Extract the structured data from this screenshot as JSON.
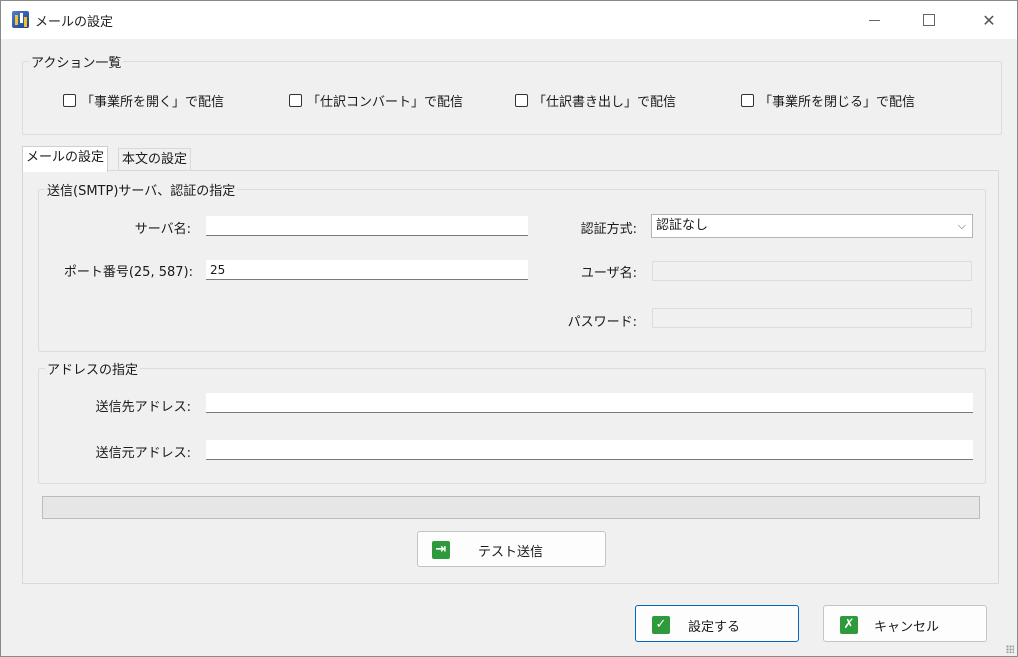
{
  "window": {
    "title": "メールの設定",
    "controls": {
      "minimize": "—",
      "maximize": "☐",
      "close": "✕"
    }
  },
  "actions": {
    "legend": "アクション一覧",
    "items": [
      {
        "label": "「事業所を開く」で配信",
        "checked": false
      },
      {
        "label": "「仕訳コンバート」で配信",
        "checked": false
      },
      {
        "label": "「仕訳書き出し」で配信",
        "checked": false
      },
      {
        "label": "「事業所を閉じる」で配信",
        "checked": false
      }
    ]
  },
  "tabs": [
    {
      "label": "メールの設定",
      "active": true
    },
    {
      "label": "本文の設定",
      "active": false
    }
  ],
  "smtp": {
    "legend": "送信(SMTP)サーバ、認証の指定",
    "server_label": "サーバ名:",
    "server_value": "",
    "port_label": "ポート番号(25, 587):",
    "port_value": "25",
    "auth_label": "認証方式:",
    "auth_value": "認証なし",
    "user_label": "ユーザ名:",
    "user_value": "",
    "password_label": "パスワード:",
    "password_value": ""
  },
  "address": {
    "legend": "アドレスの指定",
    "to_label": "送信先アドレス:",
    "to_value": "",
    "from_label": "送信元アドレス:",
    "from_value": ""
  },
  "progress": {
    "value": 0
  },
  "buttons": {
    "test_send": "テスト送信",
    "ok": "設定する",
    "cancel": "キャンセル"
  },
  "icons": {
    "test_send": "send-icon",
    "ok": "check-icon",
    "cancel": "cross-icon"
  }
}
